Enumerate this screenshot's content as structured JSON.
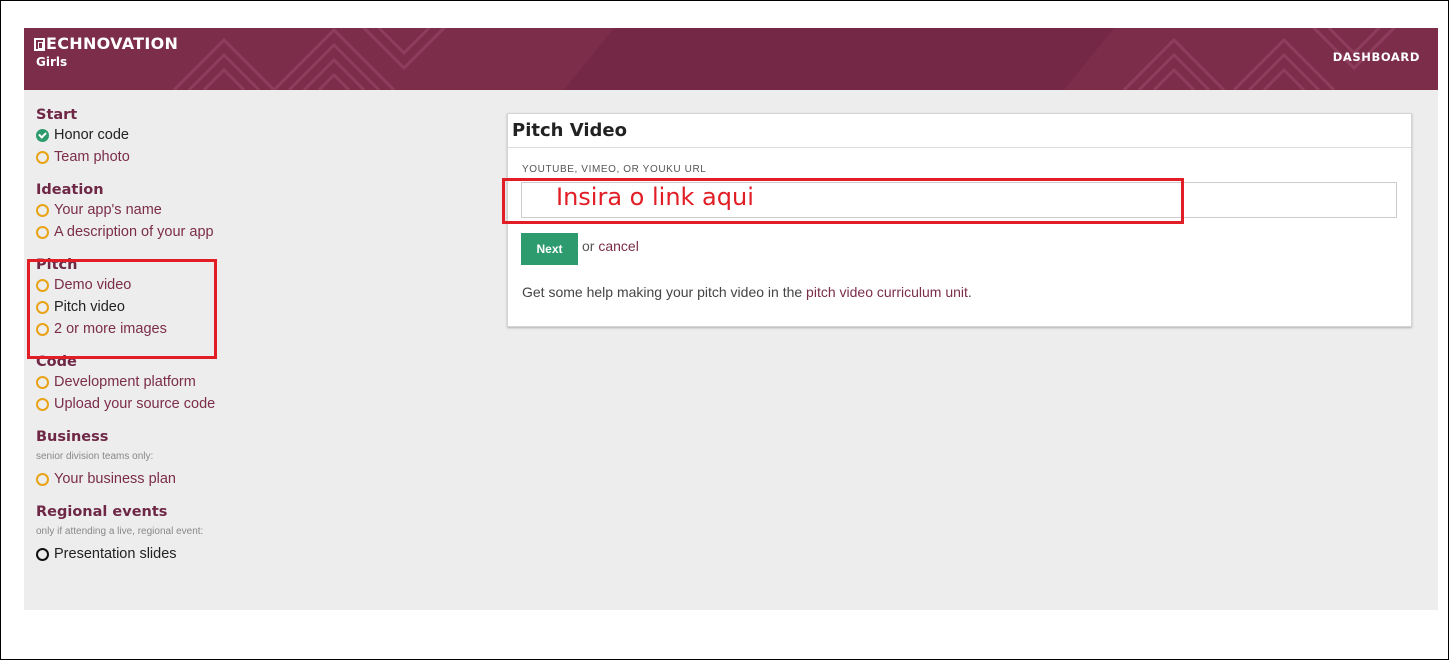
{
  "header": {
    "logo_line1": "ECHNOVATION",
    "logo_line2": "Girls",
    "dashboard_link": "DASHBOARD"
  },
  "sidebar": {
    "sections": [
      {
        "title": "Start",
        "items": [
          {
            "label": "Honor code",
            "status": "complete"
          },
          {
            "label": "Team photo",
            "status": "incomplete"
          }
        ]
      },
      {
        "title": "Ideation",
        "items": [
          {
            "label": "Your app's name",
            "status": "incomplete"
          },
          {
            "label": "A description of your app",
            "status": "incomplete"
          }
        ]
      },
      {
        "title": "Pitch",
        "items": [
          {
            "label": "Demo video",
            "status": "incomplete"
          },
          {
            "label": "Pitch video",
            "status": "current"
          },
          {
            "label": "2 or more images",
            "status": "incomplete"
          }
        ]
      },
      {
        "title": "Code",
        "items": [
          {
            "label": "Development platform",
            "status": "incomplete"
          },
          {
            "label": "Upload your source code",
            "status": "incomplete"
          }
        ]
      },
      {
        "title": "Business",
        "note": "senior division teams only:",
        "items": [
          {
            "label": "Your business plan",
            "status": "incomplete"
          }
        ]
      },
      {
        "title": "Regional events",
        "note": "only if attending a live, regional event:",
        "items": [
          {
            "label": "Presentation slides",
            "status": "optional"
          }
        ]
      }
    ]
  },
  "card": {
    "title": "Pitch Video",
    "field_label": "YOUTUBE, VIMEO, OR YOUKU URL",
    "input_value": "",
    "overlay_annotation": "Insira o link aqui",
    "next_button": "Next",
    "or_text": "or",
    "cancel_link": "cancel",
    "help_prefix": "Get some help making your pitch video in the",
    "help_link": "pitch video curriculum unit",
    "help_suffix": "."
  },
  "colors": {
    "brand": "#7b2d4a",
    "success": "#2e9b6e",
    "pending": "#e8a317",
    "annotation": "#e11d25"
  }
}
